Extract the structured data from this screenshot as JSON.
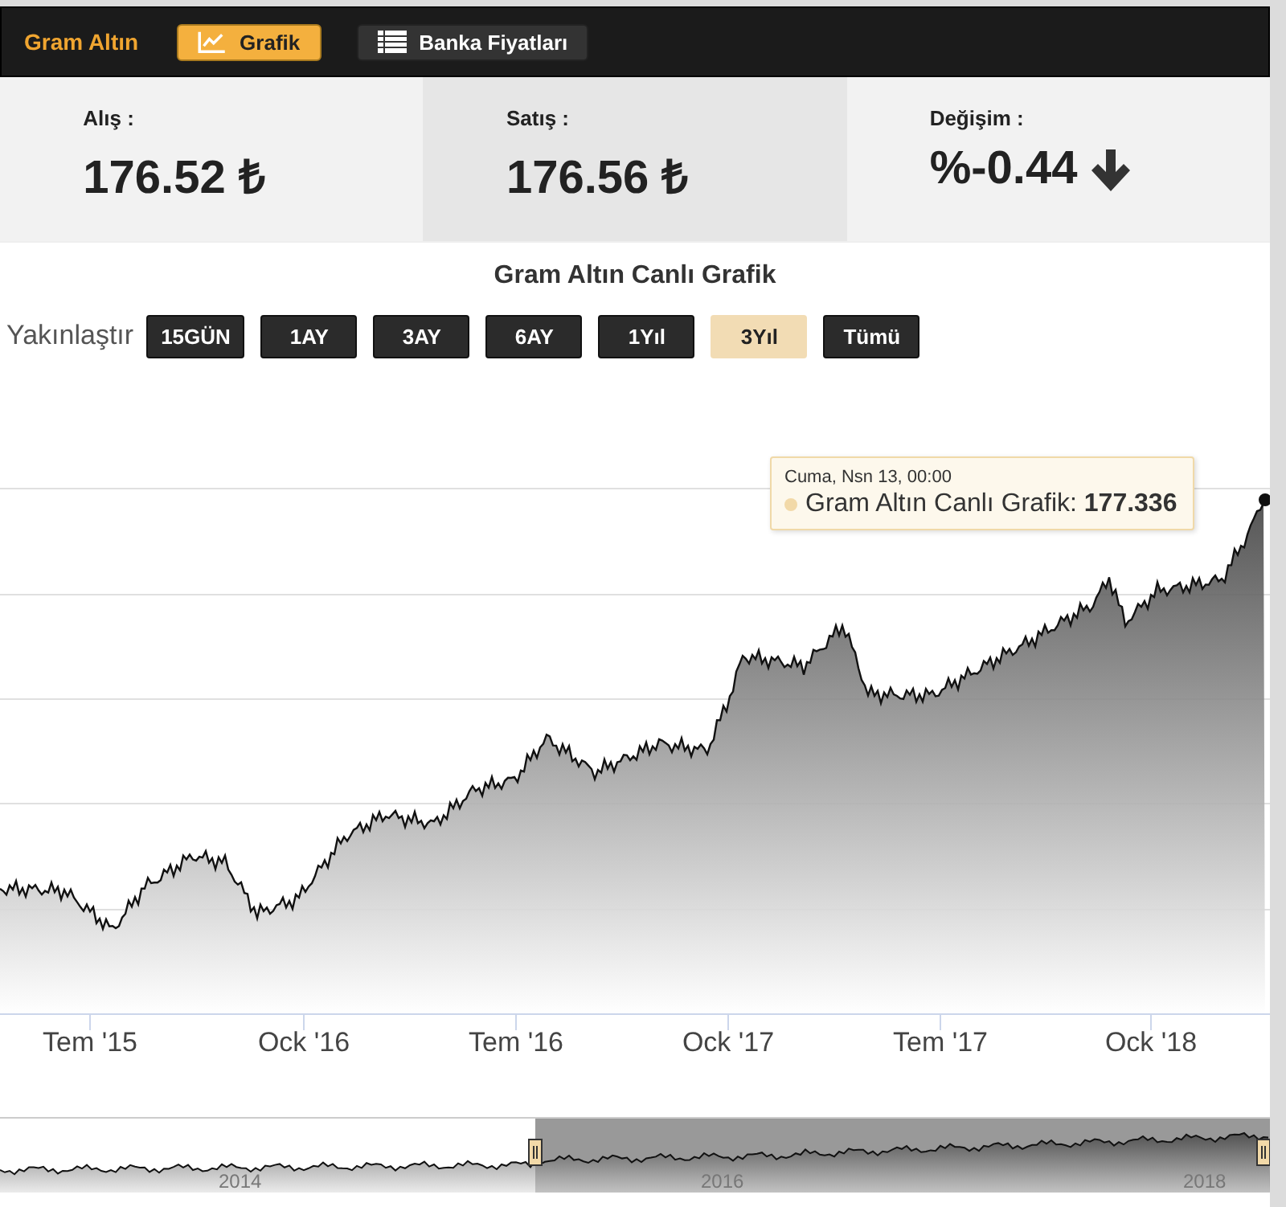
{
  "header": {
    "title": "Gram Altın",
    "tabs": [
      {
        "label": "Grafik",
        "kind": "chart",
        "selected": true
      },
      {
        "label": "Banka Fiyatları",
        "kind": "list",
        "selected": false
      }
    ]
  },
  "prices": [
    {
      "label": "Alış :",
      "value": "176.52 ₺",
      "highlighted": false
    },
    {
      "label": "Satış :",
      "value": "176.56 ₺",
      "highlighted": true
    },
    {
      "label": "Değişim :",
      "value": "%-0.44",
      "kind": "falling",
      "highlighted": false
    }
  ],
  "chart": {
    "title": "Gram Altın Canlı Grafik",
    "zoom_label": "Yakınlaştır",
    "ranges": [
      {
        "label": "15GÜN",
        "selected": false
      },
      {
        "label": "1AY",
        "selected": false
      },
      {
        "label": "3AY",
        "selected": false
      },
      {
        "label": "6AY",
        "selected": false
      },
      {
        "label": "1Yıl",
        "selected": false
      },
      {
        "label": "3Yıl",
        "selected": true
      },
      {
        "label": "Tümü",
        "selected": false
      }
    ],
    "tooltip": {
      "date": "Cuma, Nsn 13, 00:00",
      "text": "Gram Altın Canlı Grafik: **177.336**"
    },
    "x_labels": [
      "Tem '15",
      "Ock '16",
      "Tem '16",
      "Ock '17",
      "Tem '17",
      "Ock '18"
    ],
    "navigator": {
      "labels": [
        "2014",
        "2016",
        "2018"
      ]
    }
  }
}
